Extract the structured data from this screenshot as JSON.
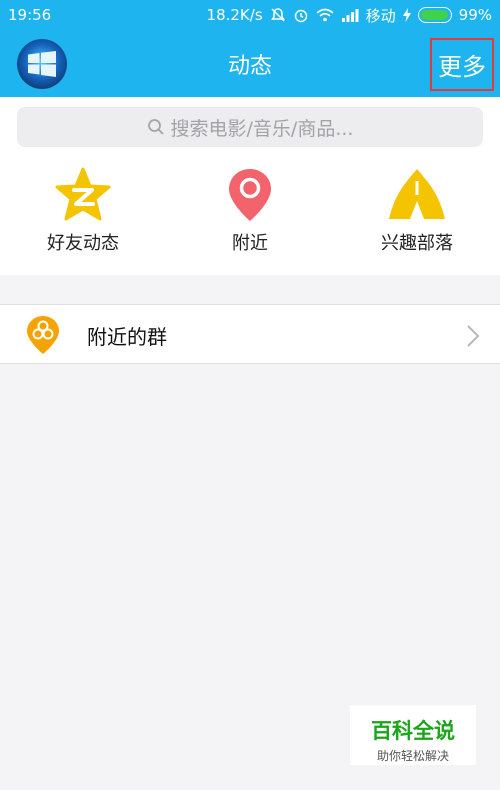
{
  "status_bar": {
    "time": "19:56",
    "speed": "18.2K/s",
    "carrier": "移动",
    "battery": "99%",
    "battery_level": 0.99
  },
  "header": {
    "title": "动态",
    "more_label": "更多"
  },
  "search": {
    "placeholder": "搜索电影/音乐/商品..."
  },
  "quick_actions": [
    {
      "label": "好友动态",
      "icon": "star-z-icon",
      "color": "#f5c400"
    },
    {
      "label": "附近",
      "icon": "location-pin-icon",
      "color": "#f2636b"
    },
    {
      "label": "兴趣部落",
      "icon": "tent-icon",
      "color": "#f5c400"
    }
  ],
  "list": {
    "nearby_groups_label": "附近的群",
    "icon": "group-pin-icon",
    "color": "#f5a300"
  },
  "watermark": {
    "title": "百科全说",
    "subtitle": "助你轻松解决"
  }
}
